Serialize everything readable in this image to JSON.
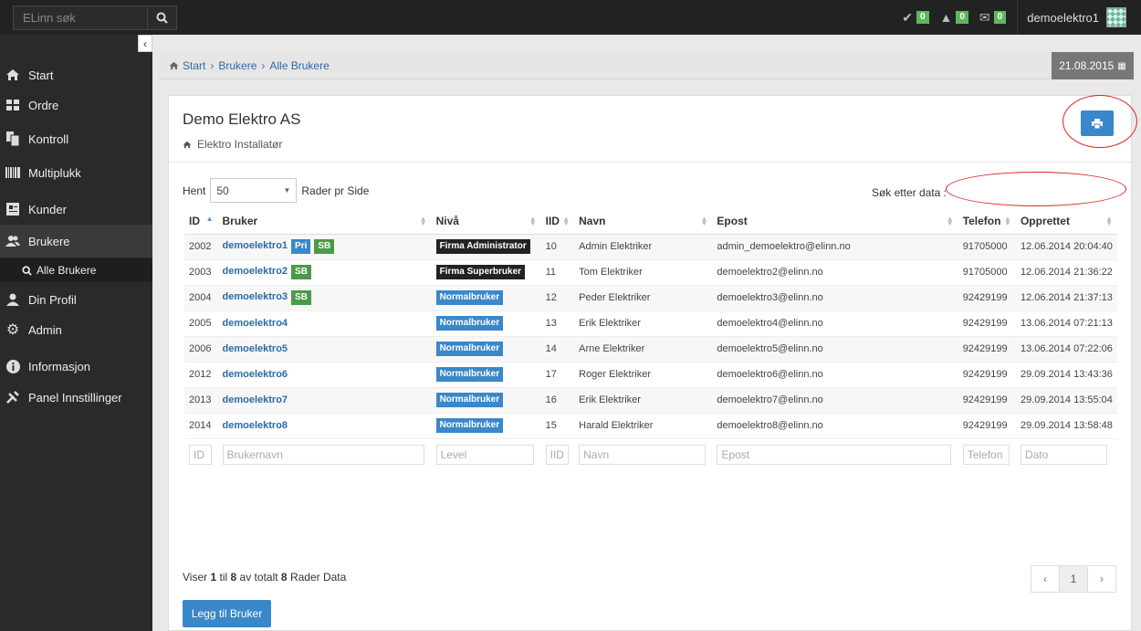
{
  "topbar": {
    "search_placeholder": "ELinn søk",
    "notifications": [
      {
        "icon": "check-icon",
        "count": "0"
      },
      {
        "icon": "warning-icon",
        "count": "0"
      },
      {
        "icon": "envelope-icon",
        "count": "0"
      }
    ],
    "username": "demoelektro1"
  },
  "sidebar": {
    "items": [
      {
        "label": "Start",
        "icon": "home-icon"
      },
      {
        "label": "Ordre",
        "icon": "grid-icon"
      },
      {
        "label": "Kontroll",
        "icon": "copy-icon"
      },
      {
        "label": "Multiplukk",
        "icon": "barcode-icon"
      },
      {
        "label": "Kunder",
        "icon": "card-icon"
      },
      {
        "label": "Brukere",
        "icon": "users-icon"
      },
      {
        "label": "Din Profil",
        "icon": "user-icon"
      },
      {
        "label": "Admin",
        "icon": "gear-icon"
      },
      {
        "label": "Informasjon",
        "icon": "info-icon"
      },
      {
        "label": "Panel Innstillinger",
        "icon": "wrench-icon"
      }
    ],
    "sub_item": "Alle Brukere"
  },
  "breadcrumb": {
    "start": "Start",
    "brukere": "Brukere",
    "alle": "Alle Brukere",
    "date": "21.08.2015"
  },
  "panel": {
    "company": "Demo Elektro AS",
    "subtitle": "Elektro Installatør",
    "hent_label": "Hent",
    "rows_value": "50",
    "rows_suffix": "Rader pr Side",
    "search_label": "Søk etter data :",
    "columns": [
      "ID",
      "Bruker",
      "Nivå",
      "IID",
      "Navn",
      "Epost",
      "Telefon",
      "Opprettet"
    ],
    "rows": [
      {
        "id": "2002",
        "user": "demoelektro1",
        "tags": [
          "Pri",
          "SB"
        ],
        "level": "Firma Administrator",
        "iid": "10",
        "name": "Admin Elektriker",
        "email": "admin_demoelektro@elinn.no",
        "phone": "91705000",
        "created": "12.06.2014 20:04:40"
      },
      {
        "id": "2003",
        "user": "demoelektro2",
        "tags": [
          "SB"
        ],
        "level": "Firma Superbruker",
        "iid": "11",
        "name": "Tom Elektriker",
        "email": "demoelektro2@elinn.no",
        "phone": "91705000",
        "created": "12.06.2014 21:36:22"
      },
      {
        "id": "2004",
        "user": "demoelektro3",
        "tags": [
          "SB"
        ],
        "level": "Normalbruker",
        "iid": "12",
        "name": "Peder Elektriker",
        "email": "demoelektro3@elinn.no",
        "phone": "92429199",
        "created": "12.06.2014 21:37:13"
      },
      {
        "id": "2005",
        "user": "demoelektro4",
        "tags": [],
        "level": "Normalbruker",
        "iid": "13",
        "name": "Erik Elektriker",
        "email": "demoelektro4@elinn.no",
        "phone": "92429199",
        "created": "13.06.2014 07:21:13"
      },
      {
        "id": "2006",
        "user": "demoelektro5",
        "tags": [],
        "level": "Normalbruker",
        "iid": "14",
        "name": "Arne Elektriker",
        "email": "demoelektro5@elinn.no",
        "phone": "92429199",
        "created": "13.06.2014 07:22:06"
      },
      {
        "id": "2012",
        "user": "demoelektro6",
        "tags": [],
        "level": "Normalbruker",
        "iid": "17",
        "name": "Roger Elektriker",
        "email": "demoelektro6@elinn.no",
        "phone": "92429199",
        "created": "29.09.2014 13:43:36"
      },
      {
        "id": "2013",
        "user": "demoelektro7",
        "tags": [],
        "level": "Normalbruker",
        "iid": "16",
        "name": "Erik Elektriker",
        "email": "demoelektro7@elinn.no",
        "phone": "92429199",
        "created": "29.09.2014 13:55:04"
      },
      {
        "id": "2014",
        "user": "demoelektro8",
        "tags": [],
        "level": "Normalbruker",
        "iid": "15",
        "name": "Harald Elektriker",
        "email": "demoelektro8@elinn.no",
        "phone": "92429199",
        "created": "29.09.2014 13:58:48"
      }
    ],
    "filters": [
      "ID",
      "Brukernavn",
      "Level",
      "IID",
      "Navn",
      "Epost",
      "Telefon",
      "Dato"
    ],
    "info": {
      "prefix": "Viser",
      "from": "1",
      "til": "til",
      "to": "8",
      "mid": "av totalt",
      "total": "8",
      "suffix": "Rader Data"
    },
    "pager": {
      "prev": "‹",
      "page": "1",
      "next": "›"
    },
    "add_button": "Legg til Bruker"
  },
  "colors": {
    "tag_pri": "#3a87c9",
    "tag_sb": "#4a9a4a",
    "level_admin": "#222222",
    "level_normal": "#3a87c9",
    "annotation": "#dd2222"
  }
}
